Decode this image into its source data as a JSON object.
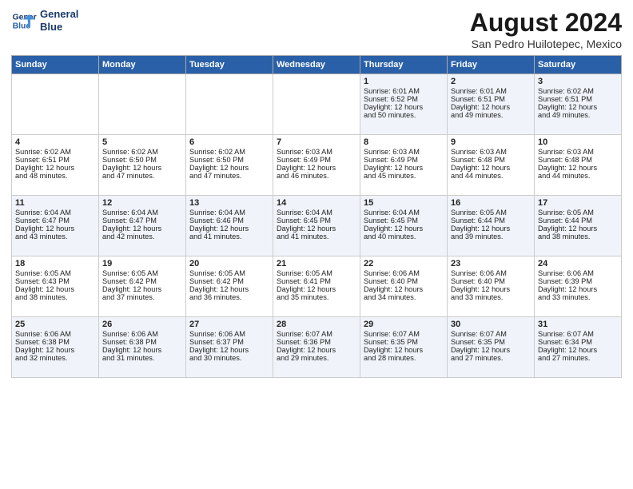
{
  "header": {
    "logo_line1": "General",
    "logo_line2": "Blue",
    "title": "August 2024",
    "subtitle": "San Pedro Huilotepec, Mexico"
  },
  "days_of_week": [
    "Sunday",
    "Monday",
    "Tuesday",
    "Wednesday",
    "Thursday",
    "Friday",
    "Saturday"
  ],
  "weeks": [
    [
      {
        "day": "",
        "info": ""
      },
      {
        "day": "",
        "info": ""
      },
      {
        "day": "",
        "info": ""
      },
      {
        "day": "",
        "info": ""
      },
      {
        "day": "1",
        "info": "Sunrise: 6:01 AM\nSunset: 6:52 PM\nDaylight: 12 hours\nand 50 minutes."
      },
      {
        "day": "2",
        "info": "Sunrise: 6:01 AM\nSunset: 6:51 PM\nDaylight: 12 hours\nand 49 minutes."
      },
      {
        "day": "3",
        "info": "Sunrise: 6:02 AM\nSunset: 6:51 PM\nDaylight: 12 hours\nand 49 minutes."
      }
    ],
    [
      {
        "day": "4",
        "info": "Sunrise: 6:02 AM\nSunset: 6:51 PM\nDaylight: 12 hours\nand 48 minutes."
      },
      {
        "day": "5",
        "info": "Sunrise: 6:02 AM\nSunset: 6:50 PM\nDaylight: 12 hours\nand 47 minutes."
      },
      {
        "day": "6",
        "info": "Sunrise: 6:02 AM\nSunset: 6:50 PM\nDaylight: 12 hours\nand 47 minutes."
      },
      {
        "day": "7",
        "info": "Sunrise: 6:03 AM\nSunset: 6:49 PM\nDaylight: 12 hours\nand 46 minutes."
      },
      {
        "day": "8",
        "info": "Sunrise: 6:03 AM\nSunset: 6:49 PM\nDaylight: 12 hours\nand 45 minutes."
      },
      {
        "day": "9",
        "info": "Sunrise: 6:03 AM\nSunset: 6:48 PM\nDaylight: 12 hours\nand 44 minutes."
      },
      {
        "day": "10",
        "info": "Sunrise: 6:03 AM\nSunset: 6:48 PM\nDaylight: 12 hours\nand 44 minutes."
      }
    ],
    [
      {
        "day": "11",
        "info": "Sunrise: 6:04 AM\nSunset: 6:47 PM\nDaylight: 12 hours\nand 43 minutes."
      },
      {
        "day": "12",
        "info": "Sunrise: 6:04 AM\nSunset: 6:47 PM\nDaylight: 12 hours\nand 42 minutes."
      },
      {
        "day": "13",
        "info": "Sunrise: 6:04 AM\nSunset: 6:46 PM\nDaylight: 12 hours\nand 41 minutes."
      },
      {
        "day": "14",
        "info": "Sunrise: 6:04 AM\nSunset: 6:45 PM\nDaylight: 12 hours\nand 41 minutes."
      },
      {
        "day": "15",
        "info": "Sunrise: 6:04 AM\nSunset: 6:45 PM\nDaylight: 12 hours\nand 40 minutes."
      },
      {
        "day": "16",
        "info": "Sunrise: 6:05 AM\nSunset: 6:44 PM\nDaylight: 12 hours\nand 39 minutes."
      },
      {
        "day": "17",
        "info": "Sunrise: 6:05 AM\nSunset: 6:44 PM\nDaylight: 12 hours\nand 38 minutes."
      }
    ],
    [
      {
        "day": "18",
        "info": "Sunrise: 6:05 AM\nSunset: 6:43 PM\nDaylight: 12 hours\nand 38 minutes."
      },
      {
        "day": "19",
        "info": "Sunrise: 6:05 AM\nSunset: 6:42 PM\nDaylight: 12 hours\nand 37 minutes."
      },
      {
        "day": "20",
        "info": "Sunrise: 6:05 AM\nSunset: 6:42 PM\nDaylight: 12 hours\nand 36 minutes."
      },
      {
        "day": "21",
        "info": "Sunrise: 6:05 AM\nSunset: 6:41 PM\nDaylight: 12 hours\nand 35 minutes."
      },
      {
        "day": "22",
        "info": "Sunrise: 6:06 AM\nSunset: 6:40 PM\nDaylight: 12 hours\nand 34 minutes."
      },
      {
        "day": "23",
        "info": "Sunrise: 6:06 AM\nSunset: 6:40 PM\nDaylight: 12 hours\nand 33 minutes."
      },
      {
        "day": "24",
        "info": "Sunrise: 6:06 AM\nSunset: 6:39 PM\nDaylight: 12 hours\nand 33 minutes."
      }
    ],
    [
      {
        "day": "25",
        "info": "Sunrise: 6:06 AM\nSunset: 6:38 PM\nDaylight: 12 hours\nand 32 minutes."
      },
      {
        "day": "26",
        "info": "Sunrise: 6:06 AM\nSunset: 6:38 PM\nDaylight: 12 hours\nand 31 minutes."
      },
      {
        "day": "27",
        "info": "Sunrise: 6:06 AM\nSunset: 6:37 PM\nDaylight: 12 hours\nand 30 minutes."
      },
      {
        "day": "28",
        "info": "Sunrise: 6:07 AM\nSunset: 6:36 PM\nDaylight: 12 hours\nand 29 minutes."
      },
      {
        "day": "29",
        "info": "Sunrise: 6:07 AM\nSunset: 6:35 PM\nDaylight: 12 hours\nand 28 minutes."
      },
      {
        "day": "30",
        "info": "Sunrise: 6:07 AM\nSunset: 6:35 PM\nDaylight: 12 hours\nand 27 minutes."
      },
      {
        "day": "31",
        "info": "Sunrise: 6:07 AM\nSunset: 6:34 PM\nDaylight: 12 hours\nand 27 minutes."
      }
    ]
  ]
}
